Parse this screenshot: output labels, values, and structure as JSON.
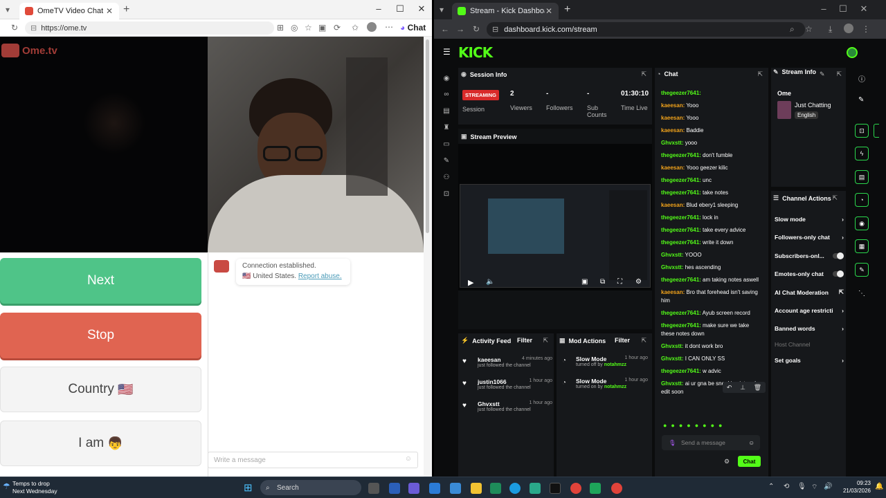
{
  "left_browser": {
    "tab_title": "OmeTV Video Chat — Omegl",
    "url": "https://ome.tv",
    "chat_ext_label": "Chat",
    "logo_text": "Ome.tv",
    "buttons": {
      "next": "Next",
      "stop": "Stop",
      "country": "Country",
      "country_flag": "🇺🇸",
      "iam": "I am",
      "iam_emoji": "👦"
    },
    "chat": {
      "status": "Connection established.",
      "country": "United States.",
      "report": "Report abuse."
    },
    "message_placeholder": "Write a message"
  },
  "right_browser": {
    "tab_title": "Stream - Kick Dashboard",
    "url": "dashboard.kick.com/stream",
    "logo": "KICK",
    "session_info": {
      "title": "Session Info",
      "badge": "STREAMING",
      "session_label": "Session",
      "stats": [
        {
          "value": "2",
          "label": "Viewers"
        },
        {
          "value": "-",
          "label": "Followers"
        },
        {
          "value": "-",
          "label": "Sub Counts"
        },
        {
          "value": "01:30:10",
          "label": "Time Live"
        }
      ]
    },
    "stream_preview_title": "Stream Preview",
    "chat": {
      "title": "Chat",
      "messages": [
        {
          "user": "thegeezer7641:",
          "text": "",
          "color": "#53fc18"
        },
        {
          "user": "kaeesan:",
          "text": "Yooo",
          "color": "#f2a31b"
        },
        {
          "user": "kaeesan:",
          "text": "Yooo",
          "color": "#f2a31b"
        },
        {
          "user": "kaeesan:",
          "text": "Baddie",
          "color": "#f2a31b"
        },
        {
          "user": "Ghvxstt:",
          "text": "yooo",
          "color": "#53fc18"
        },
        {
          "user": "thegeezer7641:",
          "text": "don't fumble",
          "color": "#53fc18"
        },
        {
          "user": "kaeesan:",
          "text": "Yooo geezer kilic",
          "color": "#f2a31b"
        },
        {
          "user": "thegeezer7641:",
          "text": "unc",
          "color": "#53fc18"
        },
        {
          "user": "thegeezer7641:",
          "text": "take notes",
          "color": "#53fc18"
        },
        {
          "user": "kaeesan:",
          "text": "Blud ebery1 sleeping",
          "color": "#f2a31b"
        },
        {
          "user": "thegeezer7641:",
          "text": "lock in",
          "color": "#53fc18"
        },
        {
          "user": "thegeezer7641:",
          "text": "take every advice",
          "color": "#53fc18"
        },
        {
          "user": "thegeezer7641:",
          "text": "write it down",
          "color": "#53fc18"
        },
        {
          "user": "Ghvxstt:",
          "text": "YOOO",
          "color": "#53fc18"
        },
        {
          "user": "Ghvxstt:",
          "text": "hes ascending",
          "color": "#53fc18"
        },
        {
          "user": "thegeezer7641:",
          "text": "am taking notes aswell",
          "color": "#53fc18"
        },
        {
          "user": "kaeesan:",
          "text": "Bro that forehead isn't saving him",
          "color": "#f2a31b"
        },
        {
          "user": "thegeezer7641:",
          "text": "Ayub screen record",
          "color": "#53fc18"
        },
        {
          "user": "thegeezer7641:",
          "text": "make sure we take these notes down",
          "color": "#53fc18"
        },
        {
          "user": "Ghvxstt:",
          "text": "it dont work bro",
          "color": "#53fc18"
        },
        {
          "user": "Ghvxstt:",
          "text": "I CAN ONLY SS",
          "color": "#53fc18"
        },
        {
          "user": "thegeezer7641:",
          "text": "w advic",
          "color": "#53fc18"
        },
        {
          "user": "Ghvxstt:",
          "text": "ai ur gna be sneaking into a bp edit soon",
          "color": "#53fc18"
        }
      ],
      "input_placeholder": "Send a message",
      "send_label": "Chat"
    },
    "stream_info": {
      "title": "Stream Info",
      "name": "Ome",
      "category": "Just Chatting",
      "language": "English"
    },
    "channel_actions": {
      "title": "Channel Actions",
      "items": [
        "Slow mode",
        "Followers-only chat",
        "Subscribers-onl...",
        "Emotes-only chat",
        "AI Chat Moderation",
        "Account age restricti",
        "Banned words",
        "Host Channel",
        "Set goals"
      ]
    },
    "activity_feed": {
      "title": "Activity Feed",
      "filter": "Filter",
      "items": [
        {
          "name": "kaeesan",
          "sub": "just followed the channel",
          "time": "4 minutes ago"
        },
        {
          "name": "justin1066",
          "sub": "just followed the channel",
          "time": "1 hour ago"
        },
        {
          "name": "Ghvxstt",
          "sub": "just followed the channel",
          "time": "1 hour ago"
        }
      ]
    },
    "mod_actions": {
      "title": "Mod Actions",
      "filter": "Filter",
      "items": [
        {
          "name": "Slow Mode",
          "sub": "turned off by",
          "by": "notahmzz",
          "time": "1 hour ago"
        },
        {
          "name": "Slow Mode",
          "sub": "turned on by",
          "by": "notahmzz",
          "time": "1 hour ago"
        }
      ]
    }
  },
  "taskbar": {
    "weather_title": "Temps to drop",
    "weather_sub": "Next Wednesday",
    "search": "Search",
    "time": "09:23",
    "date": "21/03/2026"
  },
  "colors": {
    "kick_green": "#53fc18",
    "next_green": "#4fc488",
    "stop_red": "#e06451",
    "streaming_red": "#d92a2a"
  }
}
